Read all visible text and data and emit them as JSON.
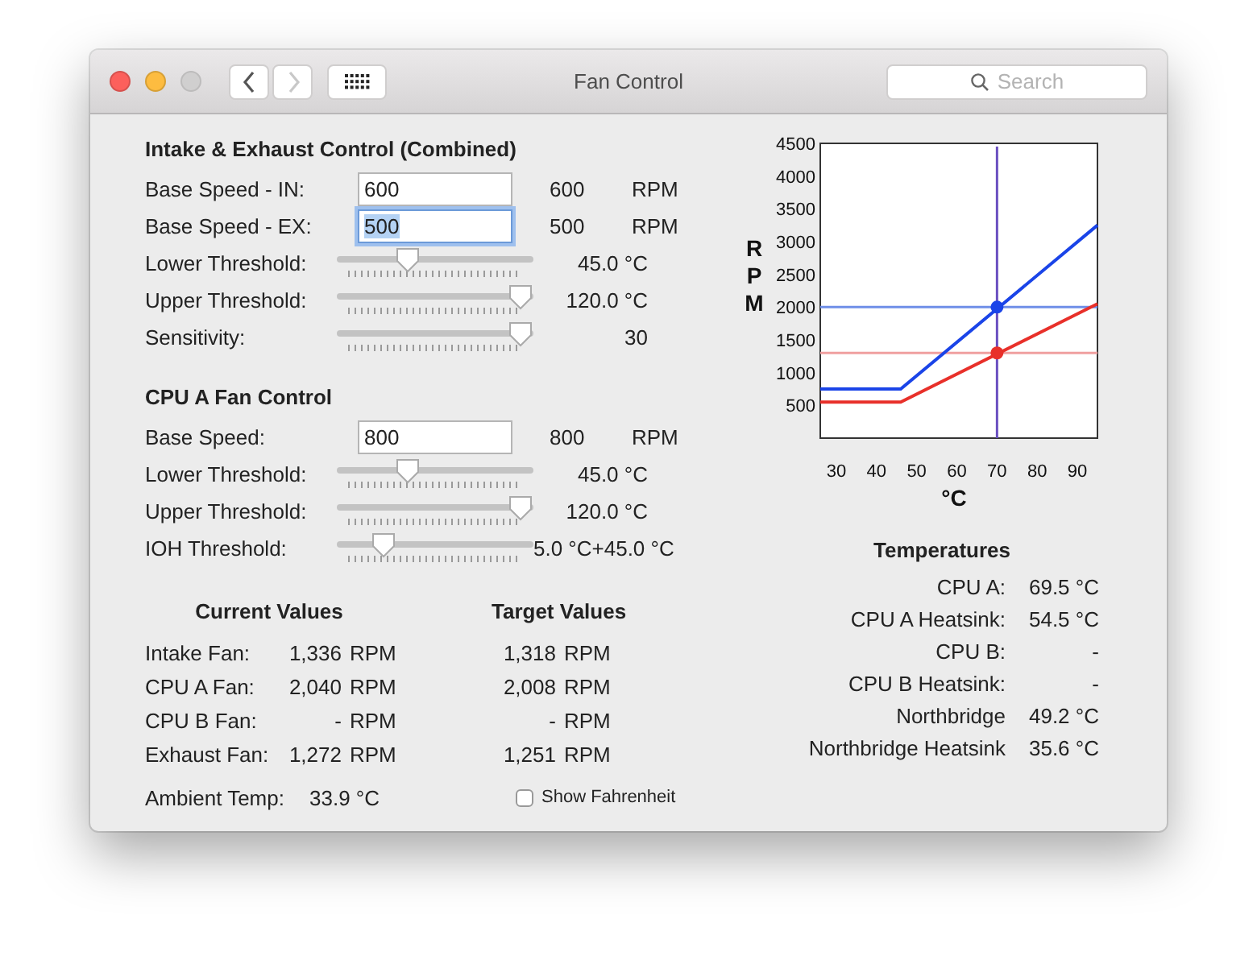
{
  "window": {
    "title": "Fan Control",
    "controls": [
      {
        "kind": "close",
        "disabled": false
      },
      {
        "kind": "minimize",
        "disabled": false
      },
      {
        "kind": "zoom",
        "disabled": true
      }
    ]
  },
  "toolbar": {
    "nav": [
      {
        "kind": "back",
        "disabled": false
      },
      {
        "kind": "forward",
        "disabled": true
      }
    ],
    "search": {
      "placeholder": "Search"
    }
  },
  "sections": [
    {
      "title": "Intake & Exhaust Control (Combined)",
      "rows": [
        {
          "kind": "field",
          "label": "Base Speed - IN:",
          "value": "600",
          "focused": false,
          "reading": "600",
          "unit": "RPM"
        },
        {
          "kind": "field",
          "label": "Base Speed - EX:",
          "value": "500",
          "focused": true,
          "reading": "500",
          "unit": "RPM"
        },
        {
          "kind": "slider",
          "label": "Lower Threshold:",
          "level": 0.34,
          "reading": "45.0 °C"
        },
        {
          "kind": "slider",
          "label": "Upper Threshold:",
          "level": 1,
          "reading": "120.0 °C"
        },
        {
          "kind": "slider",
          "label": "Sensitivity:",
          "level": 1,
          "reading": "30"
        }
      ]
    },
    {
      "title": "CPU A Fan Control",
      "rows": [
        {
          "kind": "field",
          "label": "Base Speed:",
          "value": "800",
          "focused": false,
          "reading": "800",
          "unit": "RPM"
        },
        {
          "kind": "slider",
          "label": "Lower Threshold:",
          "level": 0.34,
          "reading": "45.0 °C"
        },
        {
          "kind": "slider",
          "label": "Upper Threshold:",
          "level": 1,
          "reading": "120.0 °C"
        },
        {
          "kind": "slider",
          "label": "IOH Threshold:",
          "level": 0.2,
          "reading": "5.0 °C+45.0 °C"
        }
      ]
    }
  ],
  "current_values": {
    "title": "Current Values",
    "rows": [
      {
        "label": "Intake Fan:",
        "value": "1,336",
        "unit": "RPM"
      },
      {
        "label": "CPU A Fan:",
        "value": "2,040",
        "unit": "RPM"
      },
      {
        "label": "CPU B Fan:",
        "value": "-",
        "unit": "RPM"
      },
      {
        "label": "Exhaust Fan:",
        "value": "1,272",
        "unit": "RPM"
      }
    ]
  },
  "target_values": {
    "title": "Target Values",
    "rows": [
      {
        "value": "1,318",
        "unit": "RPM"
      },
      {
        "value": "2,008",
        "unit": "RPM"
      },
      {
        "value": "-",
        "unit": "RPM"
      },
      {
        "value": "1,251",
        "unit": "RPM"
      }
    ]
  },
  "ambient": {
    "label": "Ambient Temp:",
    "value": "33.9 °C"
  },
  "show_fahrenheit": {
    "label": "Show Fahrenheit",
    "checked": false
  },
  "chart": {
    "chart_data": {
      "type": "line",
      "xlabel": "°C",
      "ylabel": "RPM",
      "x": [
        26,
        46,
        95
      ],
      "series": [
        {
          "color": "#1a44e8",
          "values": [
            750,
            750,
            3250
          ]
        },
        {
          "color": "#e8302a",
          "values": [
            550,
            550,
            2050
          ]
        }
      ],
      "xlim": [
        26,
        95
      ],
      "ylim": [
        0,
        4500
      ],
      "xticks": [
        30,
        40,
        50,
        60,
        70,
        80,
        90
      ],
      "yticks": [
        500,
        1000,
        1500,
        2000,
        2500,
        3000,
        3500,
        4000,
        4500
      ],
      "ref_lines": [
        {
          "axis": "y",
          "value": 2000,
          "color": "#6f8fe8"
        },
        {
          "axis": "y",
          "value": 1300,
          "color": "#f0a0a0"
        },
        {
          "axis": "x",
          "value": 70,
          "color": "#6a4fc0"
        }
      ]
    }
  },
  "temperatures": {
    "title": "Temperatures",
    "rows": [
      {
        "label": "CPU A:",
        "value": "69.5 °C"
      },
      {
        "label": "CPU A Heatsink:",
        "value": "54.5 °C"
      },
      {
        "label": "CPU B:",
        "value": "-"
      },
      {
        "label": "CPU B Heatsink:",
        "value": "-"
      },
      {
        "label": "Northbridge",
        "value": "49.2 °C"
      },
      {
        "label": "Northbridge Heatsink",
        "value": "35.6 °C"
      }
    ]
  }
}
